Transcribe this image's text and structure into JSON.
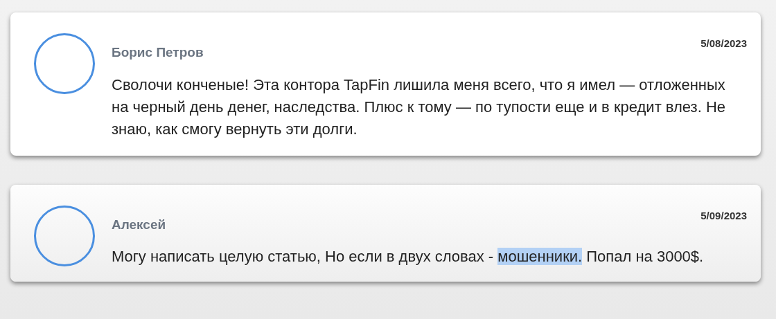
{
  "reviews": [
    {
      "author": "Борис Петров",
      "date": "5/08/2023",
      "body": [
        {
          "text": "Сволочи конченые! Эта контора TapFin лишила меня всего, что я имел — отложенных на черный день денег, наследства. Плюс к тому — по тупости еще и в кредит влез. Не знаю, как смогу вернуть эти долги.",
          "selected": false
        }
      ]
    },
    {
      "author": "Алексей",
      "date": "5/09/2023",
      "body": [
        {
          "text": "Могу написать целую статью, Но если в двух словах - ",
          "selected": false
        },
        {
          "text": "мошенники.",
          "selected": true
        },
        {
          "text": " Попал на 3000$.",
          "selected": false
        }
      ]
    }
  ]
}
